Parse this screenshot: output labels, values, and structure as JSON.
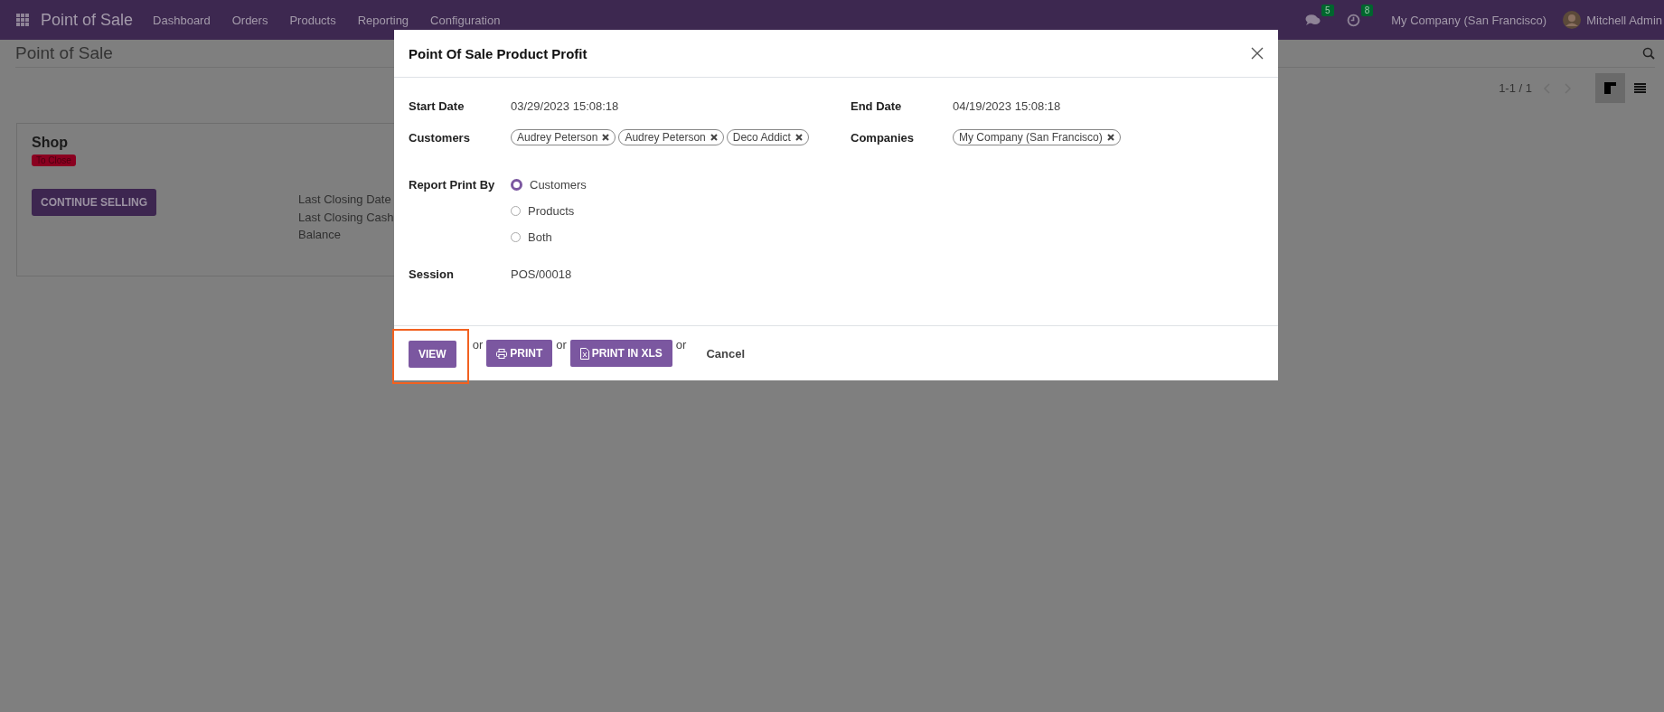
{
  "navbar": {
    "app_title": "Point of Sale",
    "menu": [
      "Dashboard",
      "Orders",
      "Products",
      "Reporting",
      "Configuration"
    ],
    "messages_count": "5",
    "activities_count": "8",
    "company": "My Company (San Francisco)",
    "user": "Mitchell Admin"
  },
  "control_panel": {
    "title": "Point of Sale",
    "pager": "1-1 / 1",
    "views": [
      {
        "kind": "kanban",
        "selected": true
      },
      {
        "kind": "list",
        "selected": false
      }
    ]
  },
  "card": {
    "title": "Shop",
    "status": "To Close",
    "button": "CONTINUE SELLING",
    "stats": [
      "Last Closing Date",
      "Last Closing Cash",
      "Balance"
    ]
  },
  "dialog": {
    "title": "Point Of Sale Product Profit",
    "fields": [
      {
        "label": "Start Date",
        "kind": "text",
        "value": "03/29/2023 15:08:18"
      },
      {
        "label": "End Date",
        "kind": "text",
        "value": "04/19/2023 15:08:18"
      },
      {
        "label": "Customers",
        "kind": "tags",
        "tags": [
          "Audrey Peterson",
          "Audrey Peterson",
          "Deco Addict"
        ]
      },
      {
        "label": "Companies",
        "kind": "tags",
        "tags": [
          "My Company (San Francisco)"
        ]
      }
    ],
    "report_print_by": {
      "label": "Report Print By",
      "options": [
        {
          "label": "Customers",
          "selected": true
        },
        {
          "label": "Products",
          "selected": false
        },
        {
          "label": "Both",
          "selected": false
        }
      ]
    },
    "session": {
      "label": "Session",
      "value": "POS/00018"
    },
    "footer": [
      {
        "kind": "view",
        "label": "VIEW",
        "highlighted": true
      },
      {
        "kind": "separator",
        "text": "or"
      },
      {
        "kind": "print",
        "label": "PRINT",
        "highlighted": false
      },
      {
        "kind": "separator",
        "text": "or"
      },
      {
        "kind": "xls",
        "label": "PRINT IN XLS",
        "highlighted": false
      },
      {
        "kind": "separator",
        "text": "or"
      },
      {
        "kind": "link",
        "label": "Cancel"
      }
    ]
  }
}
